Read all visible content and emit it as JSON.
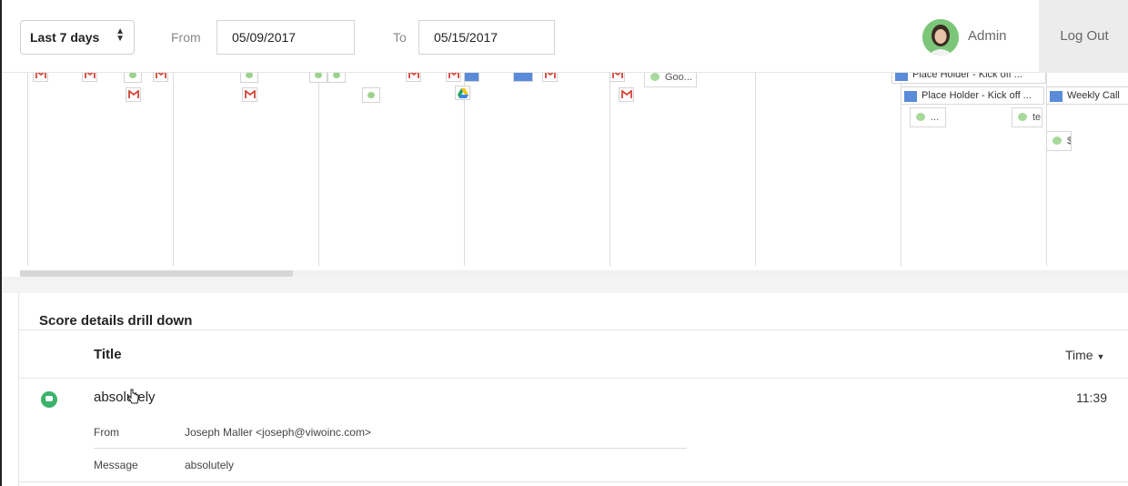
{
  "header": {
    "range_select": "Last 7 days",
    "from_label": "From",
    "from_date": "05/09/2017",
    "to_label": "To",
    "to_date": "05/15/2017",
    "user_name": "Admin",
    "logout_label": "Log Out"
  },
  "timeline": {
    "event_chips": [
      {
        "label": "Place Holder - Kick off ..."
      },
      {
        "label": "Weekly Call"
      }
    ],
    "top_chips": [
      {
        "label": "Goo..."
      },
      {
        "label": "Place Holder - Kick off ..."
      }
    ],
    "call_chips": [
      {
        "label": "..."
      },
      {
        "label": "te"
      },
      {
        "label": "$"
      }
    ]
  },
  "drill": {
    "title": "Score details drill down",
    "col_title": "Title",
    "col_time": "Time",
    "row": {
      "title": "absolutely",
      "time": "11:39",
      "from_label": "From",
      "from_value": "Joseph Maller <joseph@viwoinc.com>",
      "message_label": "Message",
      "message_value": "absolutely"
    }
  },
  "colors": {
    "accent_green": "#3bb36b",
    "gmail_red": "#d44638",
    "calendar_blue": "#5a8bd9"
  }
}
